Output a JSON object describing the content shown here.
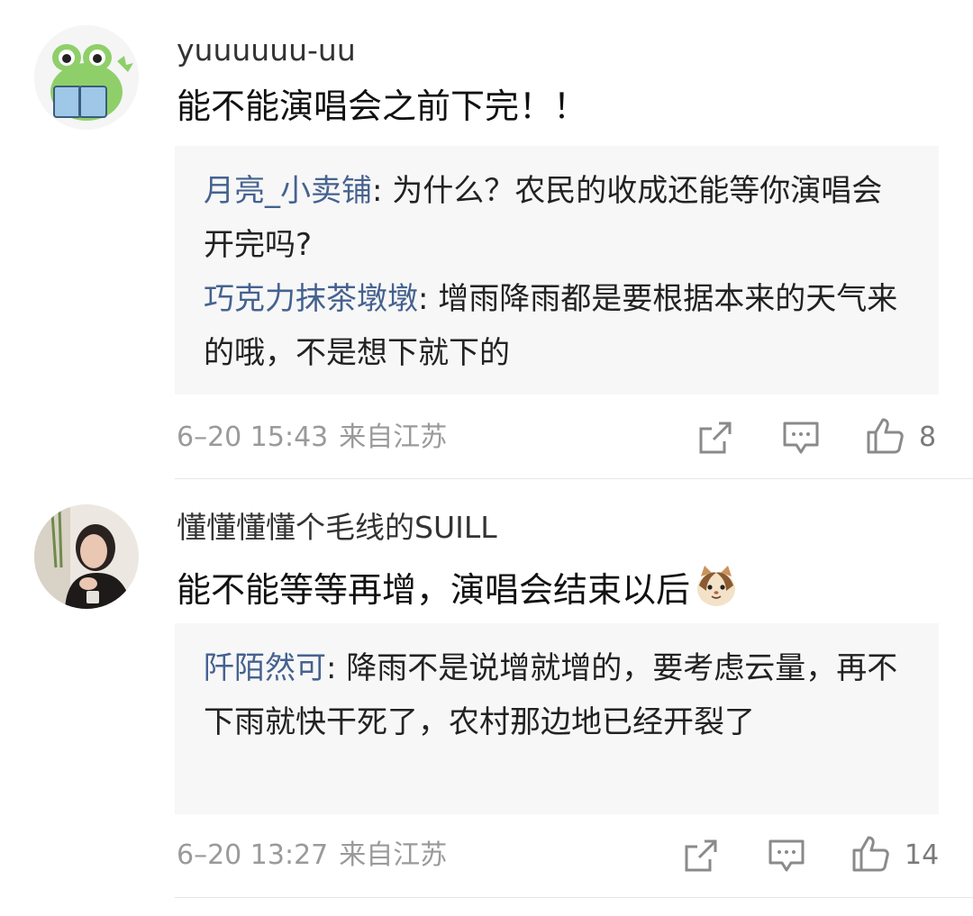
{
  "comments": [
    {
      "username": "yuuuuuu-uu",
      "text": "能不能演唱会之前下完！！",
      "replies": [
        {
          "name": "月亮_小卖铺",
          "sep": ": ",
          "text": "为什么？农民的收成还能等你演唱会开完吗?"
        },
        {
          "name": "巧克力抹茶墩墩",
          "sep": ": ",
          "text": "增雨降雨都是要根据本来的天气来的哦，不是想下就下的"
        }
      ],
      "date": "6–20 15:43",
      "location": "来自江苏",
      "likes": "8"
    },
    {
      "username": "懂懂懂懂个毛线的SUILL",
      "text": "能不能等等再增，演唱会结束以后",
      "replies": [
        {
          "name": "阡陌然可",
          "sep": ": ",
          "text": "降雨不是说增就增的，要考虑云量，再不下雨就快干死了，农村那边地已经开裂了"
        }
      ],
      "date": "6–20 13:27",
      "location": "来自江苏",
      "likes": "14"
    }
  ],
  "icons": {
    "repost": "share-square-icon",
    "comment": "comment-bubble-icon",
    "like": "thumbs-up-icon",
    "emoji": "cat-face-emoji-icon"
  },
  "colors": {
    "reply_name": "#45628f",
    "reply_bg": "#f7f7f7",
    "meta": "#9a9a9a",
    "avatar_green": "#8fcf6a"
  }
}
